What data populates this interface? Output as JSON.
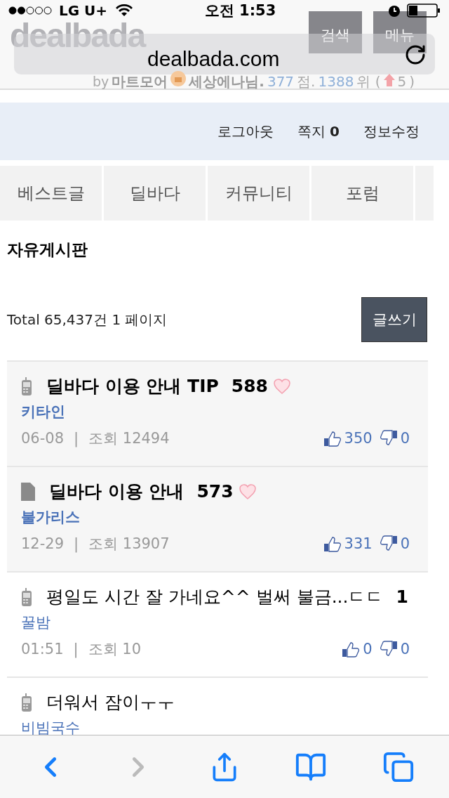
{
  "status_bar": {
    "carrier": "LG U+",
    "time": "오전 1:53"
  },
  "site_header": {
    "logo": "dealbada",
    "buttons": [
      "검색",
      "메뉴"
    ],
    "user_line": {
      "by": "by",
      "nickname": "마트모어",
      "name": "세상에나님.",
      "points": "377",
      "points_unit": "점.",
      "rank": "1388",
      "rank_unit": "위 (",
      "change": "5",
      "close": ")"
    }
  },
  "address_bar": {
    "url": "dealbada.com"
  },
  "account_bar": [
    {
      "label": "로그아웃"
    },
    {
      "label": "쪽지",
      "count": "0"
    },
    {
      "label": "정보수정"
    }
  ],
  "tabs": [
    {
      "label": "베스트글",
      "selected": false
    },
    {
      "label": "딜바다",
      "selected": false
    },
    {
      "label": "커뮤니티",
      "selected": false
    },
    {
      "label": "포럼",
      "selected": false
    }
  ],
  "board": {
    "title": "자유게시판",
    "total": "Total 65,437건 1 페이지",
    "write_button": "글쓰기"
  },
  "posts": [
    {
      "kind": "mobile",
      "notice": true,
      "title": "딜바다 이용 안내 TIP",
      "comments": "588",
      "author": "키타인",
      "date": "06-08",
      "separator": "|",
      "views": "조회 12494",
      "likes": "350",
      "dislikes": "0"
    },
    {
      "kind": "document",
      "notice": true,
      "title": "딜바다 이용 안내",
      "comments": "573",
      "author": "불가리스",
      "date": "12-29",
      "separator": "|",
      "views": "조회 13907",
      "likes": "331",
      "dislikes": "0"
    },
    {
      "kind": "mobile",
      "notice": false,
      "title": "평일도 시간 잘 가네요^^ 벌써 불금...ㄷㄷ",
      "comments": "1",
      "author": "꿀밤",
      "date": "01:51",
      "separator": "|",
      "views": "조회 10",
      "likes": "0",
      "dislikes": "0"
    },
    {
      "kind": "mobile",
      "notice": false,
      "title": "더워서 잠이ㅜㅜ",
      "author": "비빔국수"
    }
  ],
  "toolbar": {
    "back": {
      "disabled": false
    },
    "forward": {
      "disabled": true
    }
  }
}
